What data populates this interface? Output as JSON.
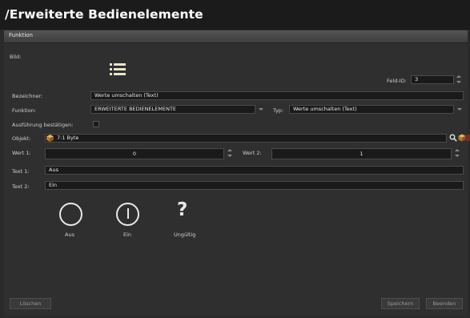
{
  "window": {
    "title": "/Erweiterte Bedienelemente"
  },
  "section": {
    "label": "Funktion"
  },
  "form": {
    "bild_label": "Bild:",
    "feld_id_label": "Feld-ID:",
    "feld_id_value": "3",
    "bezeichner_label": "Bezeichner:",
    "bezeichner_value": "Werte umschalten (Text)",
    "funktion_label": "Funktion:",
    "funktion_value": "ERWEITERTE BEDIENELEMENTE",
    "typ_label": "Typ:",
    "typ_value": "Werte umschalten (Text)",
    "ausfuehrung_label": "Ausführung bestätigen:",
    "objekt_label": "Objekt:",
    "objekt_value": "7:1 Byte",
    "wert1_label": "Wert 1:",
    "wert1_value": "0",
    "wert2_label": "Wert 2:",
    "wert2_value": "1",
    "text1_label": "Text 1:",
    "text1_value": "Aus",
    "text2_label": "Text 2:",
    "text2_value": "Ein"
  },
  "preview": {
    "aus_label": "Aus",
    "ein_label": "Ein",
    "ungueltig_label": "Ungültig"
  },
  "buttons": {
    "loeschen": "Löschen",
    "speichern": "Speichern",
    "beenden": "Beenden"
  },
  "icons": [
    "list-icon",
    "spinner-up-icon",
    "spinner-down-icon",
    "dropdown-arrow-icon",
    "object-cube-icon",
    "search-icon",
    "object-add-icon",
    "object-remove-icon",
    "circle-off-icon",
    "circle-on-icon",
    "question-icon"
  ]
}
